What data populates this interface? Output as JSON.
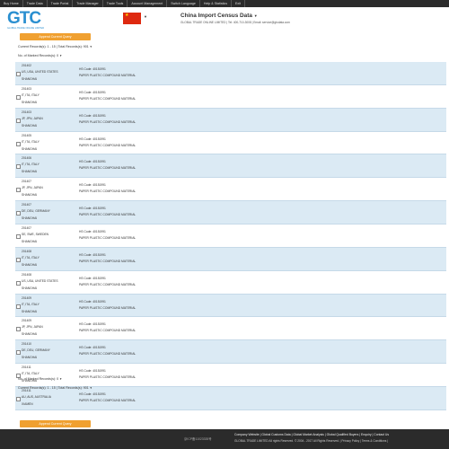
{
  "nav": [
    "Buy Home",
    "Trade Data",
    "Trade Portal",
    "Trade Manager",
    "Trade Tools",
    "Account Management",
    "Switch Language",
    "Help & Statistics",
    "Exit"
  ],
  "logo": {
    "text": "GTC",
    "tagline": "GLOBAL TRADE ONLINE LIMITED"
  },
  "header": {
    "title": "China Import Census Data",
    "contact": "GLOBAL TRADE ONLINE LIMITED | Tel: 400-710-3008 | Email: service@gtodata.com"
  },
  "buttons": {
    "append_top": "Append Current Query",
    "append_bottom": "Append Current Query"
  },
  "records_top": {
    "current": "Current Records(s): 1 - 15",
    "total": "Total Records(s): 901"
  },
  "marked_top": "No. of Marked Records(s): 0",
  "marked_bottom": "No. of Marked Records(s): 0",
  "records_bottom": {
    "current": "Current Records(s): 1 - 15",
    "total": "Total Records(s): 901"
  },
  "rows": [
    {
      "date": "201402",
      "country": "US, USA, UNITED STATES",
      "port": "SHANGHAI",
      "hs": "HS Code: 40151991",
      "desc": "PAPER PLASTIC COMPOUND MATERIAL"
    },
    {
      "date": "201403",
      "country": "IT, ITA, ITALY",
      "port": "SHANGHAI",
      "hs": "HS Code: 40151991",
      "desc": "PAPER PLASTIC COMPOUND MATERIAL"
    },
    {
      "date": "201403",
      "country": "JP, JPN, JAPAN",
      "port": "SHANGHAI",
      "hs": "HS Code: 40151991",
      "desc": "PAPER PLASTIC COMPOUND MATERIAL"
    },
    {
      "date": "201405",
      "country": "IT, ITA, ITALY",
      "port": "SHANGHAI",
      "hs": "HS Code: 40151991",
      "desc": "PAPER PLASTIC COMPOUND MATERIAL"
    },
    {
      "date": "201406",
      "country": "IT, ITA, ITALY",
      "port": "SHANGHAI",
      "hs": "HS Code: 40151991",
      "desc": "PAPER PLASTIC COMPOUND MATERIAL"
    },
    {
      "date": "201407",
      "country": "JP, JPN, JAPAN",
      "port": "SHANGHAI",
      "hs": "HS Code: 40151991",
      "desc": "PAPER PLASTIC COMPOUND MATERIAL"
    },
    {
      "date": "201407",
      "country": "DE, DEU, GERMANY",
      "port": "SHANGHAI",
      "hs": "HS Code: 40151991",
      "desc": "PAPER PLASTIC COMPOUND MATERIAL"
    },
    {
      "date": "201407",
      "country": "SE, SWE, SWEDEN",
      "port": "SHANGHAI",
      "hs": "HS Code: 40151991",
      "desc": "PAPER PLASTIC COMPOUND MATERIAL"
    },
    {
      "date": "201408",
      "country": "IT, ITA, ITALY",
      "port": "SHANGHAI",
      "hs": "HS Code: 40151991",
      "desc": "PAPER PLASTIC COMPOUND MATERIAL"
    },
    {
      "date": "201408",
      "country": "US, USA, UNITED STATES",
      "port": "SHANGHAI",
      "hs": "HS Code: 40151991",
      "desc": "PAPER PLASTIC COMPOUND MATERIAL"
    },
    {
      "date": "201409",
      "country": "IT, ITA, ITALY",
      "port": "SHANGHAI",
      "hs": "HS Code: 40151991",
      "desc": "PAPER PLASTIC COMPOUND MATERIAL"
    },
    {
      "date": "201409",
      "country": "JP, JPN, JAPAN",
      "port": "SHANGHAI",
      "hs": "HS Code: 40151991",
      "desc": "PAPER PLASTIC COMPOUND MATERIAL"
    },
    {
      "date": "201410",
      "country": "DE, DEU, GERMANY",
      "port": "SHANGHAI",
      "hs": "HS Code: 40151991",
      "desc": "PAPER PLASTIC COMPOUND MATERIAL"
    },
    {
      "date": "201411",
      "country": "IT, ITA, ITALY",
      "port": "SHANGHAI",
      "hs": "HS Code: 40151991",
      "desc": "PAPER PLASTIC COMPOUND MATERIAL"
    },
    {
      "date": "201411",
      "country": "AU, AUS, AUSTRALIA",
      "port": "XIAMEN",
      "hs": "HS Code: 40151991",
      "desc": "PAPER PLASTIC COMPOUND MATERIAL"
    }
  ],
  "footer": {
    "icp": "京ICP备11023335号",
    "links": "Company Website | Global Customs Data | Global Market Analysis | Global Qualified Buyers | Enquiry | Contact Us",
    "copyright": "GLOBAL TRADE LIMITED All rights Reserved. © 2004 - 2017 All Rights Reserved. | Privacy Policy | Terms & Conditions |"
  }
}
